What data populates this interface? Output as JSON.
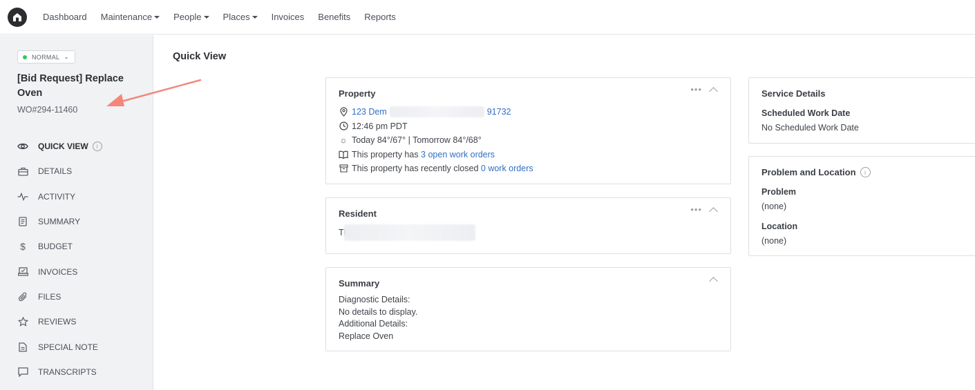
{
  "nav": {
    "items": [
      {
        "label": "Dashboard",
        "dropdown": false
      },
      {
        "label": "Maintenance",
        "dropdown": true
      },
      {
        "label": "People",
        "dropdown": true
      },
      {
        "label": "Places",
        "dropdown": true
      },
      {
        "label": "Invoices",
        "dropdown": false
      },
      {
        "label": "Benefits",
        "dropdown": false
      },
      {
        "label": "Reports",
        "dropdown": false
      }
    ]
  },
  "sidebar": {
    "priority": "NORMAL",
    "priority_color": "#34c759",
    "title": "[Bid Request] Replace Oven",
    "wo_number": "WO#294-11460",
    "menu": [
      {
        "label": "QUICK VIEW",
        "icon": "eye-icon",
        "active": true
      },
      {
        "label": "DETAILS",
        "icon": "briefcase-icon"
      },
      {
        "label": "ACTIVITY",
        "icon": "activity-icon"
      },
      {
        "label": "SUMMARY",
        "icon": "document-icon"
      },
      {
        "label": "BUDGET",
        "icon": "dollar-icon"
      },
      {
        "label": "INVOICES",
        "icon": "invoice-icon"
      },
      {
        "label": "FILES",
        "icon": "paperclip-icon"
      },
      {
        "label": "REVIEWS",
        "icon": "star-icon"
      },
      {
        "label": "SPECIAL NOTE",
        "icon": "note-icon"
      },
      {
        "label": "TRANSCRIPTS",
        "icon": "chat-icon"
      }
    ]
  },
  "main": {
    "title": "Quick View",
    "property": {
      "title": "Property",
      "address_start": "123 Dem",
      "address_end": "91732",
      "time": "12:46 pm PDT",
      "weather": "Today 84°/67° | Tomorrow 84°/68°",
      "open_prefix": "This property has ",
      "open_link": "3 open work orders",
      "closed_prefix": "This property has recently closed ",
      "closed_link": "0 work orders"
    },
    "resident": {
      "title": "Resident",
      "name_start": "Tl"
    },
    "summary": {
      "title": "Summary",
      "lines": [
        "Diagnostic Details:",
        "No details to display.",
        "Additional Details:",
        "Replace Oven"
      ]
    },
    "service": {
      "title": "Service Details",
      "scheduled_label": "Scheduled Work Date",
      "scheduled_value": "No Scheduled Work Date"
    },
    "problem_location": {
      "title": "Problem and Location",
      "problem_label": "Problem",
      "problem_value": "(none)",
      "location_label": "Location",
      "location_value": "(none)"
    }
  },
  "colors": {
    "link": "#2f6fc4",
    "annotation_arrow": "#f4877a",
    "sidebar_bg": "#f1f2f4"
  }
}
